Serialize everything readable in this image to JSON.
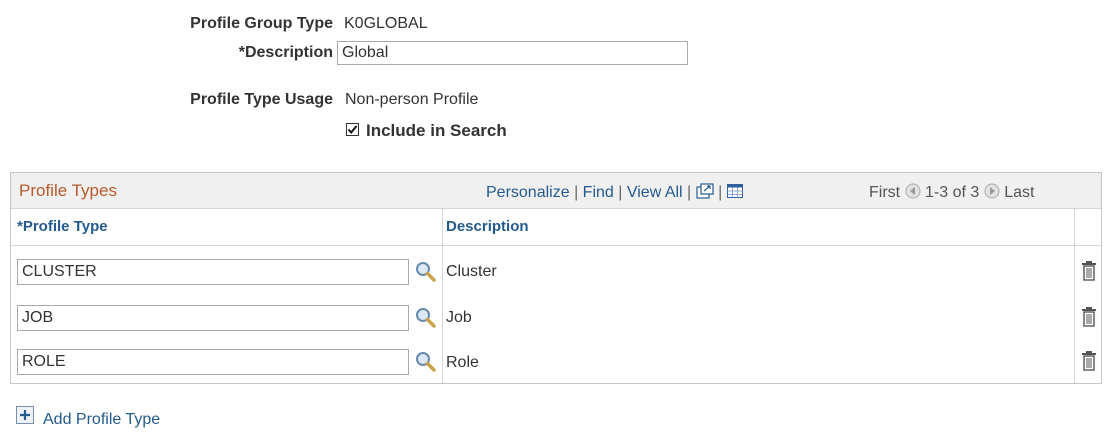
{
  "form": {
    "profile_group_type_label": "Profile Group Type",
    "profile_group_type_value": "K0GLOBAL",
    "description_label": "*Description",
    "description_value": "Global",
    "profile_type_usage_label": "Profile Type Usage",
    "profile_type_usage_value": "Non-person Profile",
    "include_in_search_label": "Include in Search",
    "include_in_search_checked": true
  },
  "grid": {
    "title": "Profile Types",
    "toolbar": {
      "personalize": "Personalize",
      "find": "Find",
      "view_all": "View All",
      "first": "First",
      "range": "1-3 of 3",
      "last": "Last",
      "separator": "|"
    },
    "columns": [
      "*Profile Type",
      "Description"
    ],
    "rows": [
      {
        "profile_type": "CLUSTER",
        "description": "Cluster"
      },
      {
        "profile_type": "JOB",
        "description": "Job"
      },
      {
        "profile_type": "ROLE",
        "description": "Role"
      }
    ]
  },
  "footer": {
    "add_label": "Add Profile Type"
  },
  "icons": {
    "lookup": "magnifier-icon",
    "delete": "trash-icon",
    "add": "plus-icon",
    "zoom": "new-window-icon",
    "download": "spreadsheet-icon",
    "prev": "arrow-left-icon",
    "next": "arrow-right-icon"
  },
  "colors": {
    "link": "#245a8c",
    "grid_title": "#b55a2b",
    "header_bg": "#f0f0f0"
  }
}
